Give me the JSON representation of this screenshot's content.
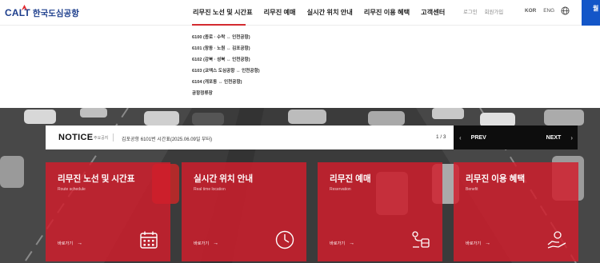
{
  "header": {
    "logo_latin": "CALT",
    "logo_korean": "한국도심공항",
    "nav": [
      {
        "label": "리무진 노선 및 시간표",
        "active": true
      },
      {
        "label": "리무진 예매"
      },
      {
        "label": "실시간 위치 안내"
      },
      {
        "label": "리무진 이용 혜택"
      },
      {
        "label": "고객센터"
      }
    ],
    "util": [
      "로그인",
      "회원가입"
    ],
    "lang": [
      "KOR",
      "ENG"
    ],
    "side_button": "월",
    "accent_color": "#d32b30",
    "brand_color": "#1d3e8c"
  },
  "dropdown": {
    "items": [
      "6100 (종로 · 수락 ↔ 인천공항)",
      "6101 (창동 · 노원 ↔ 김포공항)",
      "6102 (강북 · 성북 ↔ 인천공항)",
      "6103 (코엑스 도심공항 ↔ 인천공항)",
      "6104 (개포동 ↔ 인천공항)",
      "공항정류장"
    ]
  },
  "notice": {
    "title": "NOTICE",
    "subtitle": "주요공지",
    "text": "김포공항 6101번 시간표(2025.06.09일 부터)",
    "page": "1 / 3",
    "prev": "PREV",
    "next": "NEXT"
  },
  "cards": [
    {
      "title": "리무진 노선 및 시간표",
      "sub": "Route schedule",
      "link": "바로가기",
      "icon": "calendar-icon"
    },
    {
      "title": "실시간 위치 안내",
      "sub": "Real time location",
      "link": "바로가기",
      "icon": "clock-icon"
    },
    {
      "title": "리무진 예매",
      "sub": "Reservation",
      "link": "바로가기",
      "icon": "route-bus-icon"
    },
    {
      "title": "리무진 이용 혜택",
      "sub": "Benefit",
      "link": "바로가기",
      "icon": "hand-coin-icon"
    }
  ],
  "card_color": "#d11e2c"
}
